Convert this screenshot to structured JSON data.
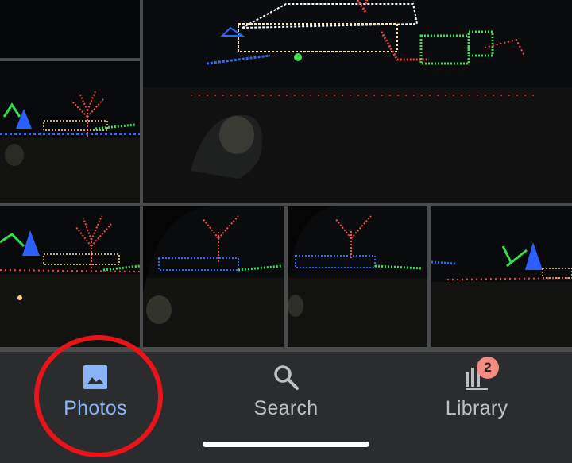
{
  "nav": {
    "tabs": [
      {
        "label": "Photos",
        "icon": "photo-icon",
        "active": true
      },
      {
        "label": "Search",
        "icon": "search-icon",
        "active": false
      },
      {
        "label": "Library",
        "icon": "library-icon",
        "active": false
      }
    ],
    "library_badge": "2"
  },
  "colors": {
    "active": "#8ab4f8",
    "inactive": "#bdc1c6",
    "badge": "#f28b82",
    "highlight_circle": "#e8141a",
    "nav_bg": "#2b2c2e"
  },
  "photo_grid": {
    "count": 7
  }
}
